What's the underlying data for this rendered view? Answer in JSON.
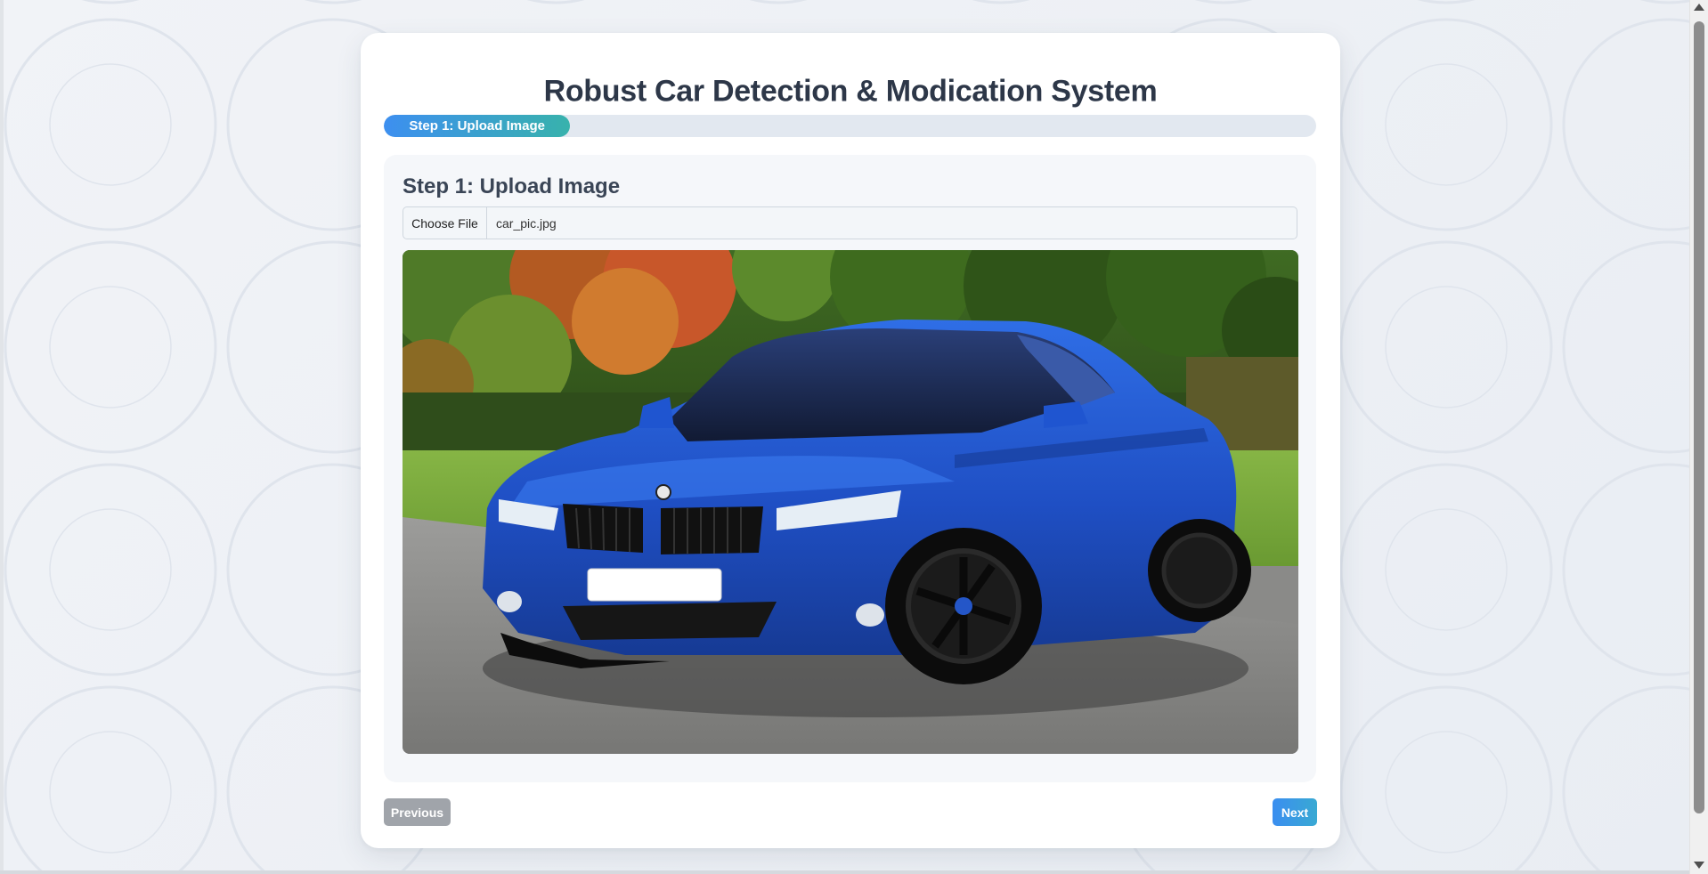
{
  "page": {
    "title": "Robust Car Detection & Modication System"
  },
  "progress": {
    "label": "Step 1: Upload Image",
    "fraction": 0.2
  },
  "step": {
    "heading": "Step 1: Upload Image",
    "file_input": {
      "button_label": "Choose File",
      "file_name": "car_pic.jpg"
    },
    "preview": {
      "alt": "Blue car photo preview"
    }
  },
  "nav": {
    "previous_label": "Previous",
    "next_label": "Next"
  },
  "colors": {
    "accent_blue": "#3d8ff0",
    "accent_teal": "#38b2ac",
    "title_text": "#2d3748",
    "disabled_button": "#a0a4aa"
  }
}
